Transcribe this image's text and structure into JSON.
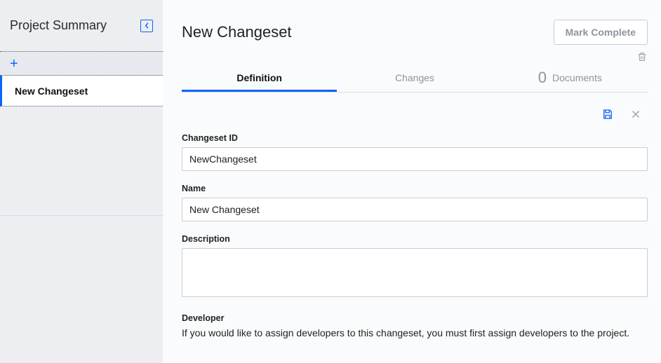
{
  "sidebar": {
    "title": "Project Summary",
    "items": [
      {
        "label": "New Changeset"
      }
    ]
  },
  "page": {
    "title": "New Changeset",
    "mark_complete_label": "Mark Complete"
  },
  "tabs": {
    "definition_label": "Definition",
    "changes_label": "Changes",
    "documents_count": "0",
    "documents_label": "Documents"
  },
  "form": {
    "changeset_id": {
      "label": "Changeset ID",
      "value": "NewChangeset"
    },
    "name": {
      "label": "Name",
      "value": "New Changeset"
    },
    "description": {
      "label": "Description",
      "value": ""
    },
    "developer": {
      "label": "Developer",
      "helper_text": "If you would like to assign developers to this changeset, you must first assign developers to the project."
    }
  }
}
